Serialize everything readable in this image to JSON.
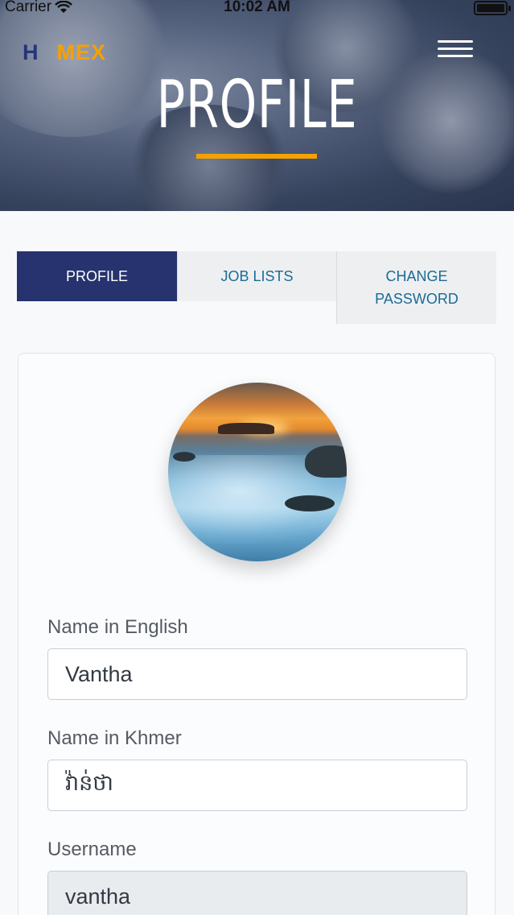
{
  "status_bar": {
    "carrier": "Carrier",
    "time": "10:02 AM"
  },
  "header": {
    "logo_part_a": "H",
    "logo_part_b": "MEX",
    "title": "PROFILE",
    "accent_color": "#f5a100",
    "menu_icon": "hamburger-menu-icon"
  },
  "tabs": [
    {
      "label": "PROFILE",
      "active": true
    },
    {
      "label": "JOB LISTS",
      "active": false
    },
    {
      "label": "CHANGE\nPASSWORD",
      "active": false
    }
  ],
  "form": {
    "name_en_label": "Name in English",
    "name_en_value": "Vantha",
    "name_km_label": "Name in Khmer",
    "name_km_value": "វ៉ាន់ថា",
    "username_label": "Username",
    "username_value": "vantha"
  },
  "colors": {
    "primary": "#26336e",
    "tab_text": "#1a6c96",
    "accent": "#f5a100"
  }
}
